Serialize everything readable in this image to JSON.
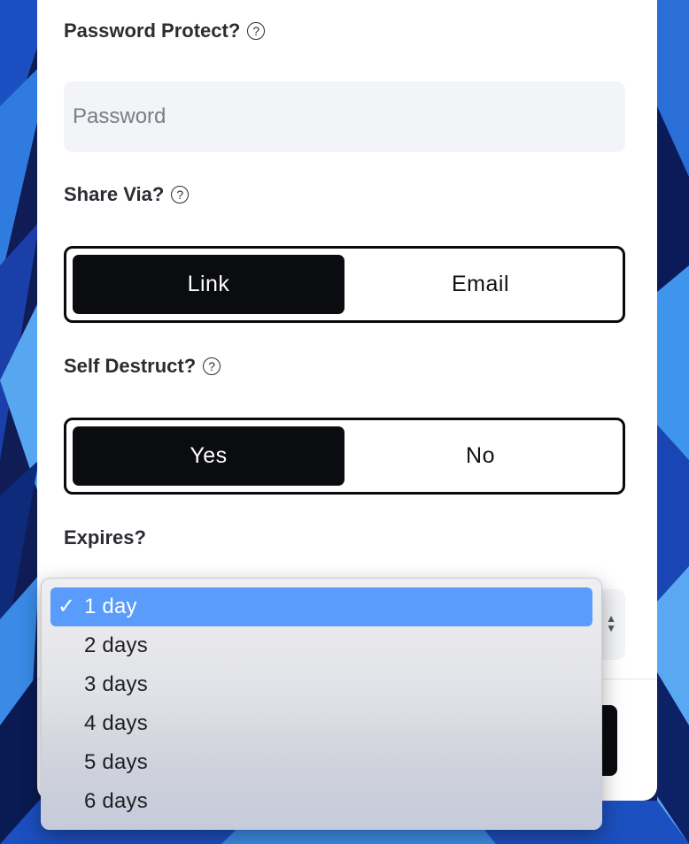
{
  "password_section": {
    "label": "Password Protect?",
    "help_icon": "?",
    "input": {
      "value": "",
      "placeholder": "Password"
    }
  },
  "share_section": {
    "label": "Share Via?",
    "help_icon": "?",
    "options": [
      "Link",
      "Email"
    ],
    "selected": "Link"
  },
  "destruct_section": {
    "label": "Self Destruct?",
    "help_icon": "?",
    "options": [
      "Yes",
      "No"
    ],
    "selected": "Yes"
  },
  "expires_section": {
    "label": "Expires?",
    "dropdown": {
      "options": [
        "1 day",
        "2 days",
        "3 days",
        "4 days",
        "5 days",
        "6 days"
      ],
      "selected": "1 day",
      "check_mark": "✓"
    }
  },
  "icons": {
    "help": "question-circle-icon",
    "select_arrows": "up-down-chevron-icon",
    "check": "checkmark-icon"
  },
  "colors": {
    "selected_highlight": "#5a9cfb",
    "segment_active_bg": "#0b0c10",
    "input_bg": "#f3f4f8"
  }
}
